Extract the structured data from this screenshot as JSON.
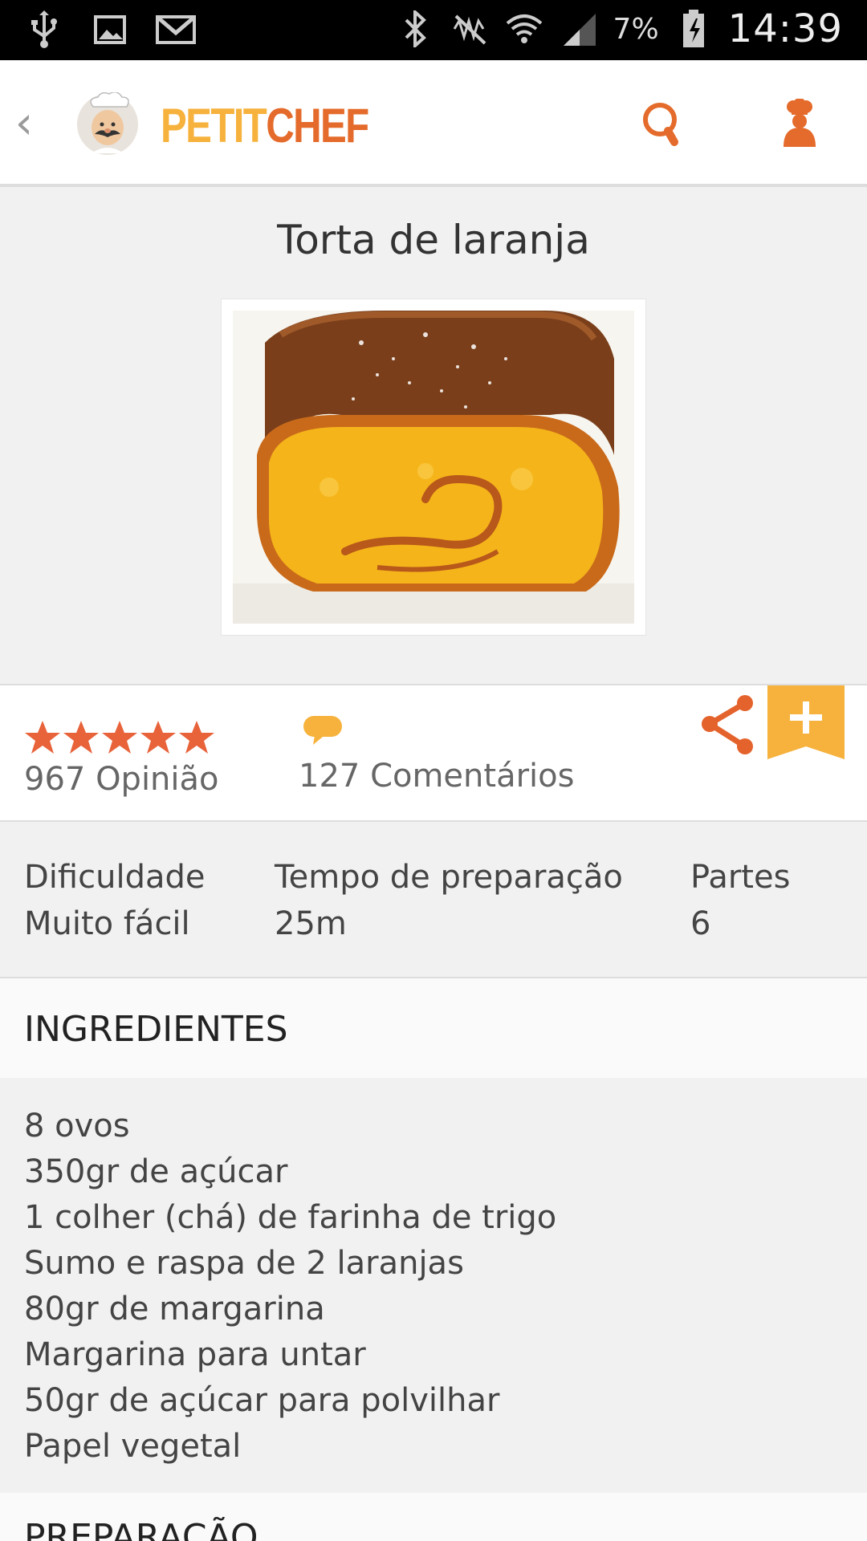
{
  "status_bar": {
    "battery": "7%",
    "time": "14:39",
    "icons": [
      "usb-icon",
      "image-icon",
      "gmail-icon",
      "bluetooth-icon",
      "mute-icon",
      "wifi-icon",
      "signal-icon",
      "battery-icon"
    ]
  },
  "app_bar": {
    "back_glyph": "‹",
    "brand_part1": "PETIT",
    "brand_part2": "CHEF",
    "colors": {
      "brand_yellow": "#f6b23c",
      "brand_orange": "#e46b2b"
    }
  },
  "recipe": {
    "title": "Torta de laranja"
  },
  "stats": {
    "rating": 5,
    "rating_max": 5,
    "opinions": "967 Opinião",
    "comments": "127 Comentários"
  },
  "info": {
    "difficulty_label": "Dificuldade",
    "difficulty_value": "Muito fácil",
    "time_label": "Tempo de preparação",
    "time_value": "25m",
    "parts_label": "Partes",
    "parts_value": "6"
  },
  "ingredients": {
    "title": "INGREDIENTES",
    "items": [
      "8 ovos",
      "350gr de açúcar",
      "1 colher (chá) de farinha de trigo",
      "Sumo e raspa de 2 laranjas",
      "80gr de margarina",
      "Margarina para untar",
      "50gr de açúcar para polvilhar",
      "Papel vegetal"
    ]
  },
  "preparation": {
    "title": "PREPARAÇÃO"
  }
}
